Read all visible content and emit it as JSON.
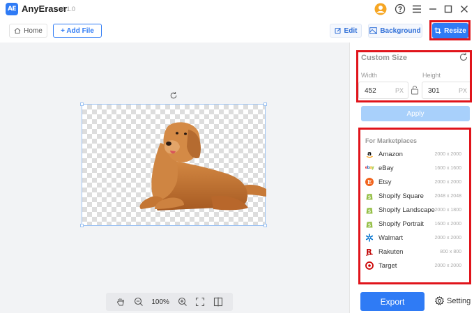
{
  "app": {
    "name": "AnyEraser",
    "version": "4.1.0",
    "logo_text": "AE"
  },
  "titlebar": {
    "icons": [
      "user-avatar-icon",
      "help-icon",
      "menu-icon",
      "minimize-icon",
      "maximize-icon",
      "close-icon"
    ]
  },
  "toolbar": {
    "home_label": "Home",
    "add_file_label": "+ Add File",
    "edit_label": "Edit",
    "background_label": "Background",
    "resize_label": "Resize"
  },
  "canvas": {
    "zoom": "100%"
  },
  "custom_size": {
    "title": "Custom Size",
    "width_label": "Width",
    "height_label": "Height",
    "width_value": "452",
    "height_value": "301",
    "unit": "PX",
    "apply_label": "Apply"
  },
  "marketplaces": {
    "title": "For Marketplaces",
    "items": [
      {
        "name": "Amazon",
        "size": "2000 x 2000"
      },
      {
        "name": "eBay",
        "size": "1600 x 1600"
      },
      {
        "name": "Etsy",
        "size": "2000 x 2000"
      },
      {
        "name": "Shopify Square",
        "size": "2048 x 2048"
      },
      {
        "name": "Shopify Landscape",
        "size": "2000 x 1800"
      },
      {
        "name": "Shopify Portrait",
        "size": "1600 x 2000"
      },
      {
        "name": "Walmart",
        "size": "2000 x 2000"
      },
      {
        "name": "Rakuten",
        "size": "800 x 800"
      },
      {
        "name": "Target",
        "size": "2000 x 2000"
      }
    ]
  },
  "footer": {
    "export_label": "Export",
    "setting_label": "Setting"
  },
  "colors": {
    "accent": "#2f7bf5",
    "highlight": "#e0141b",
    "apply_disabled": "#a8d0fb"
  }
}
